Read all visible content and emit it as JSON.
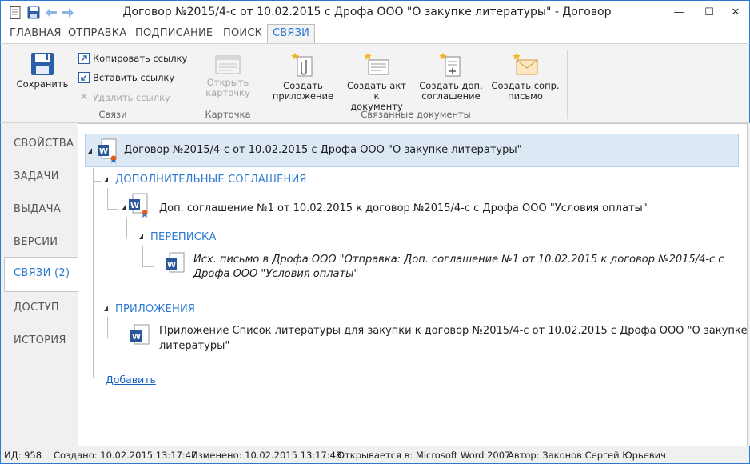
{
  "window": {
    "title": "Договор №2015/4-с от 10.02.2015 с Дрофа ООО \"О закупке литературы\" - Договор",
    "minimize": "—",
    "maximize": "☐",
    "close": "✕"
  },
  "ribbon_tabs": [
    "ГЛАВНАЯ",
    "ОТПРАВКА",
    "ПОДПИСАНИЕ",
    "ПОИСК",
    "СВЯЗИ"
  ],
  "ribbon": {
    "save_label": "Сохранить",
    "copy_link": "Копировать ссылку",
    "paste_link": "Вставить ссылку",
    "delete_link": "Удалить ссылку",
    "group_links": "Связи",
    "open_card_l1": "Открыть",
    "open_card_l2": "карточку",
    "group_card": "Карточка",
    "create_attachment_l1": "Создать",
    "create_attachment_l2": "приложение",
    "create_act_l1": "Создать акт к",
    "create_act_l2": "документу",
    "create_agreement_l1": "Создать доп.",
    "create_agreement_l2": "соглашение",
    "create_letter_l1": "Создать сопр.",
    "create_letter_l2": "письмо",
    "group_related": "Связанные документы"
  },
  "nav": [
    "СВОЙСТВА",
    "ЗАДАЧИ",
    "ВЫДАЧА",
    "ВЕРСИИ",
    "СВЯЗИ (2)",
    "ДОСТУП",
    "ИСТОРИЯ"
  ],
  "tree": {
    "root": "Договор №2015/4-с от 10.02.2015 с Дрофа ООО \"О закупке литературы\"",
    "group_agreements": "ДОПОЛНИТЕЛЬНЫЕ СОГЛАШЕНИЯ",
    "agreement": "Доп. соглашение №1 от 10.02.2015 к договор №2015/4-с с Дрофа ООО \"Условия оплаты\"",
    "group_correspondence": "ПЕРЕПИСКА",
    "letter_l1": "Исх. письмо в Дрофа ООО \"Отправка: Доп. соглашение №1 от 10.02.2015 к договор №2015/4-с с",
    "letter_l2": "Дрофа ООО \"Условия оплаты\"",
    "group_attachments": "ПРИЛОЖЕНИЯ",
    "attachment_l1": "Приложение Список литературы для закупки к договор №2015/4-с от 10.02.2015 с Дрофа ООО \"О закупке",
    "attachment_l2": "литературы\"",
    "add_link": "Добавить"
  },
  "status": {
    "id": "ИД: 958",
    "created": "Создано: 10.02.2015 13:17:47",
    "modified": "Изменено: 10.02.2015 13:17:48",
    "opens_in": "Открывается в: Microsoft Word 2007",
    "author": "Автор: Законов Сергей Юрьевич"
  },
  "colors": {
    "accent": "#2b79d1",
    "selection": "#dce8f4",
    "word_blue": "#2b579a",
    "badge_orange": "#e25a1c"
  }
}
